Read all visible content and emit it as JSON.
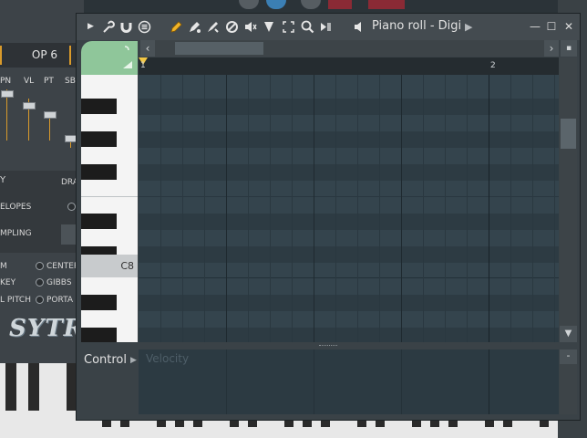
{
  "background_plugin": {
    "op_label": "OP 6",
    "slider_labels": [
      "PN",
      "VL",
      "PT",
      "SB"
    ],
    "rows": [
      {
        "label": "Y",
        "extra": "DRA"
      },
      {
        "label": "ELOPES"
      },
      {
        "label": "MPLING"
      },
      {
        "label": "M",
        "option": "CENTER"
      },
      {
        "label": "KEY",
        "option": "GIBBS"
      },
      {
        "label": "L PITCH",
        "option": "PORTA"
      }
    ],
    "logo": "SYTRU"
  },
  "window": {
    "title": "Piano roll - Digi",
    "toolbar_icons": [
      "arrow-right-icon",
      "wrench-icon",
      "magnet-icon",
      "menu-icon",
      "pencil-icon",
      "paint-icon",
      "brush-icon",
      "delete-icon",
      "mute-icon",
      "slice-icon",
      "select-icon",
      "zoom-icon",
      "playback-icon",
      "speaker-icon"
    ],
    "buttons": {
      "minimize": "—",
      "maximize": "☐",
      "close": "✕"
    },
    "ruler": {
      "bars": [
        "1",
        "2"
      ]
    },
    "key_label": "C8",
    "control": {
      "label": "Control",
      "event": "Velocity"
    }
  },
  "colors": {
    "accent_orange": "#d99a2b",
    "corner_green": "#8fc69a",
    "grid_bg": "#34444d",
    "playhead_yellow": "#f2c744"
  }
}
